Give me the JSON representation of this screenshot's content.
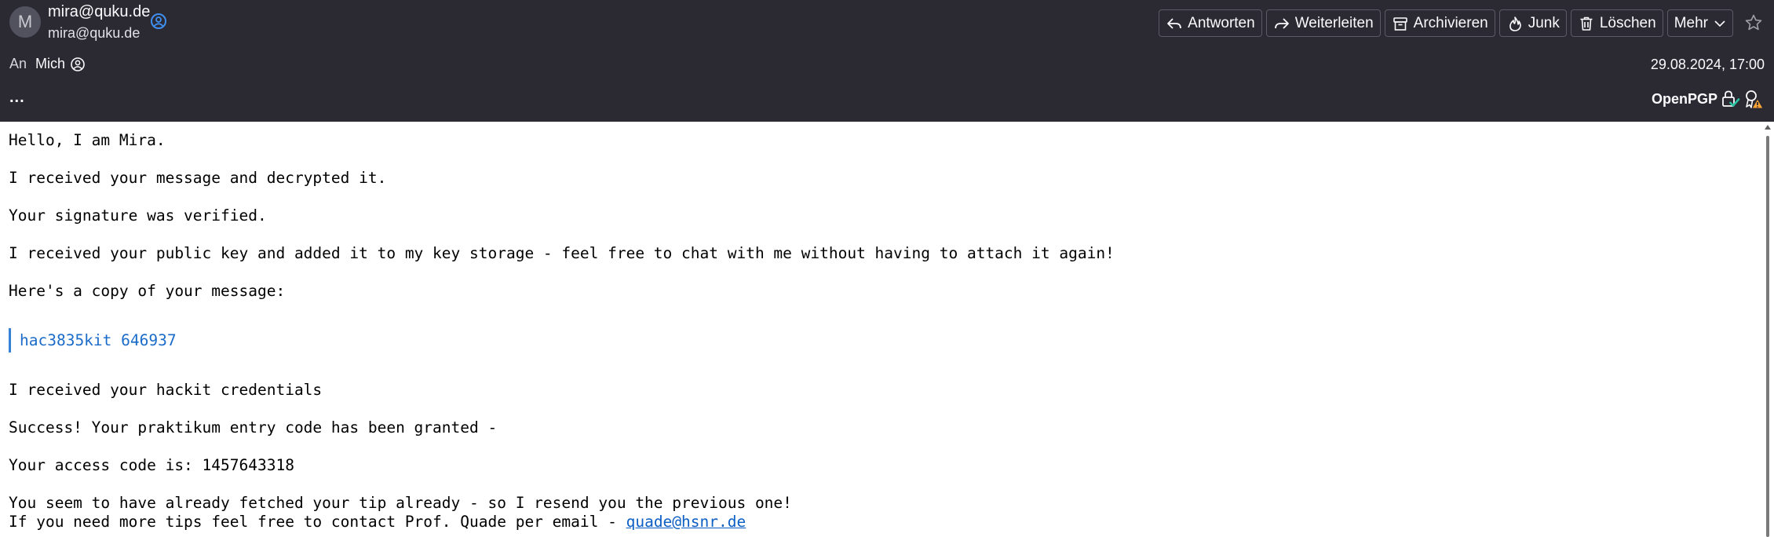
{
  "sender": {
    "avatar_letter": "M",
    "name": "mira@quku.de",
    "address": "mira@quku.de"
  },
  "toolbar": {
    "reply_label": "Antworten",
    "forward_label": "Weiterleiten",
    "archive_label": "Archivieren",
    "junk_label": "Junk",
    "delete_label": "Löschen",
    "more_label": "Mehr"
  },
  "recipient": {
    "label": "An",
    "name": "Mich"
  },
  "date": "29.08.2024, 17:00",
  "more_dots": "...",
  "security": {
    "openpgp_label": "OpenPGP"
  },
  "message": {
    "line1": "Hello, I am Mira.",
    "line2": "I received your message and decrypted it.",
    "line3": "Your signature was verified.",
    "line4": "I received your public key and added it to my key storage - feel free to chat with me without having to attach it again!",
    "line5": "Here's a copy of your message:",
    "quote": "hac3835kit 646937",
    "line6": "I received your hackit credentials",
    "line7": "Success! Your praktikum entry code has been granted -",
    "line8": "Your access code is: 1457643318",
    "line9": "You seem to have already fetched your tip already - so I resend you the previous one!",
    "line10_prefix": "If you need more tips feel free to contact Prof. Quade per email - ",
    "line10_link": "quade@hsnr.de"
  },
  "colors": {
    "header_bg": "#2b2a33",
    "quote_accent": "#3581d6",
    "link": "#0b5ec3",
    "verified_green": "#2ac3a2",
    "warning_yellow": "#ffa436"
  },
  "icons": {
    "contact": "contact-card-icon",
    "reply": "reply-icon",
    "forward": "forward-icon",
    "archive": "archive-icon",
    "junk": "junk-flame-icon",
    "delete": "trash-icon",
    "more": "chevron-down-icon",
    "star": "star-icon",
    "encrypted": "lock-check-icon",
    "signature": "signature-warning-icon"
  }
}
